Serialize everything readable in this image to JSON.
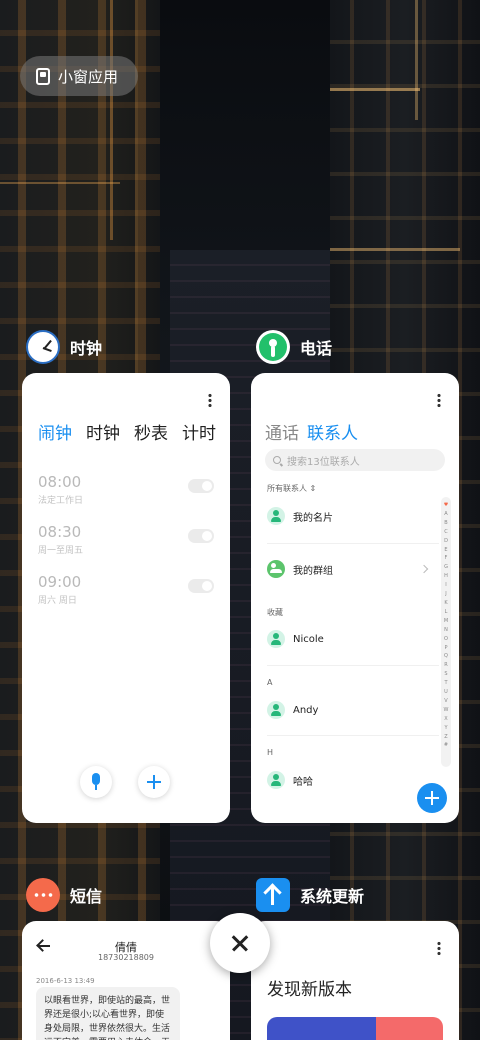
{
  "pill": {
    "label": "小窗应用",
    "icon": "small-window-icon"
  },
  "apps": {
    "clock": {
      "name": "时钟",
      "tabs": [
        "闹钟",
        "时钟",
        "秒表",
        "计时"
      ],
      "active_tab": "闹钟",
      "alarms": [
        {
          "time": "08:00",
          "repeat": "法定工作日",
          "enabled": false
        },
        {
          "time": "08:30",
          "repeat": "周一至周五",
          "enabled": false
        },
        {
          "time": "09:00",
          "repeat": "周六 周日",
          "enabled": false
        }
      ]
    },
    "phone": {
      "name": "电话",
      "tabs": [
        "通话",
        "联系人"
      ],
      "active_tab": "联系人",
      "search_placeholder": "搜索13位联系人",
      "section_all": "所有联系人",
      "rows": {
        "my_card": "我的名片",
        "my_groups": "我的群组"
      },
      "sections": {
        "fav": "收藏",
        "a": "A",
        "h": "H"
      },
      "contacts": {
        "nicole": "Nicole",
        "andy": "Andy",
        "haha": "哈哈"
      },
      "index_letters": [
        "♥",
        "A",
        "B",
        "C",
        "D",
        "E",
        "F",
        "G",
        "H",
        "I",
        "J",
        "K",
        "L",
        "M",
        "N",
        "O",
        "P",
        "Q",
        "R",
        "S",
        "T",
        "U",
        "V",
        "W",
        "X",
        "Y",
        "Z",
        "#"
      ]
    },
    "sms": {
      "name": "短信",
      "contact_name": "倩倩",
      "contact_number": "18730218809",
      "date": "2016-6-13 13:49",
      "message": "以眼看世界，即使站的最高，世界还是很小;以心看世界，即使身处局限，世界依然很大。生活远不完美，需要用心去体会，无需取灭去"
    },
    "update": {
      "name": "系统更新",
      "title": "发现新版本"
    }
  },
  "colors": {
    "accent": "#1a8ff0",
    "close_bg": "#ffffff"
  }
}
